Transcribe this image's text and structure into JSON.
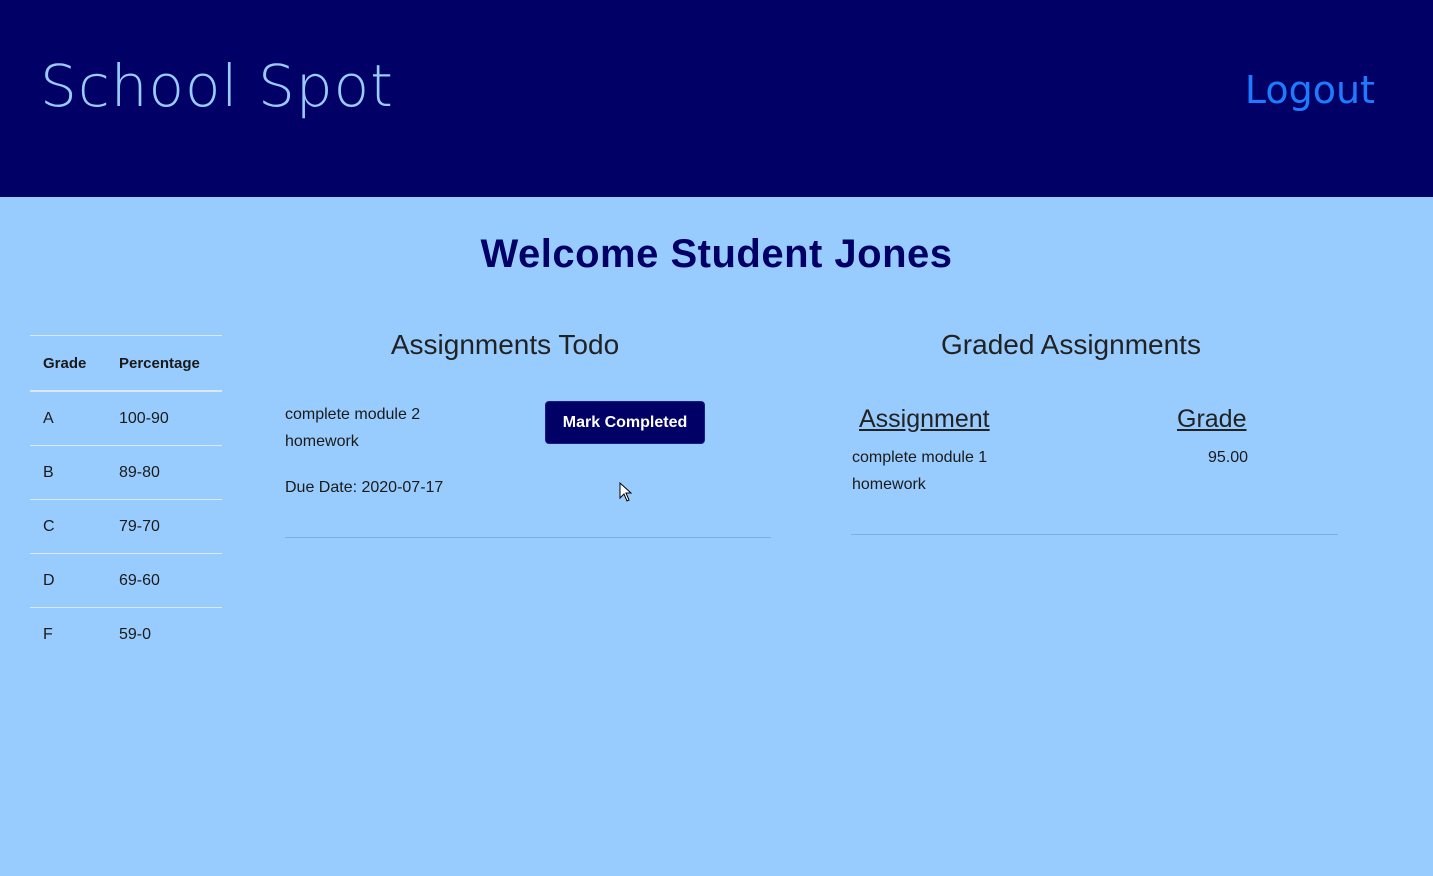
{
  "header": {
    "brand": "School Spot",
    "logout_label": "Logout"
  },
  "welcome": "Welcome Student Jones",
  "grade_scale": {
    "headers": [
      "Grade",
      "Percentage"
    ],
    "rows": [
      {
        "grade": "A",
        "percentage": "100-90"
      },
      {
        "grade": "B",
        "percentage": "89-80"
      },
      {
        "grade": "C",
        "percentage": "79-70"
      },
      {
        "grade": "D",
        "percentage": "69-60"
      },
      {
        "grade": "F",
        "percentage": "59-0"
      }
    ]
  },
  "todo": {
    "title": "Assignments Todo",
    "items": [
      {
        "name": "complete module 2 homework",
        "due": "Due Date: 2020-07-17",
        "button_label": "Mark Completed"
      }
    ]
  },
  "graded": {
    "title": "Graded Assignments",
    "col_assignment": "Assignment",
    "col_grade": "Grade",
    "items": [
      {
        "name": "complete module 1 homework",
        "grade": "95.00"
      }
    ]
  },
  "colors": {
    "header_bg": "#000066",
    "page_bg": "#99ccfe",
    "brand": "#99ccfe",
    "logout": "#1e7bff",
    "button_bg": "#000066"
  }
}
